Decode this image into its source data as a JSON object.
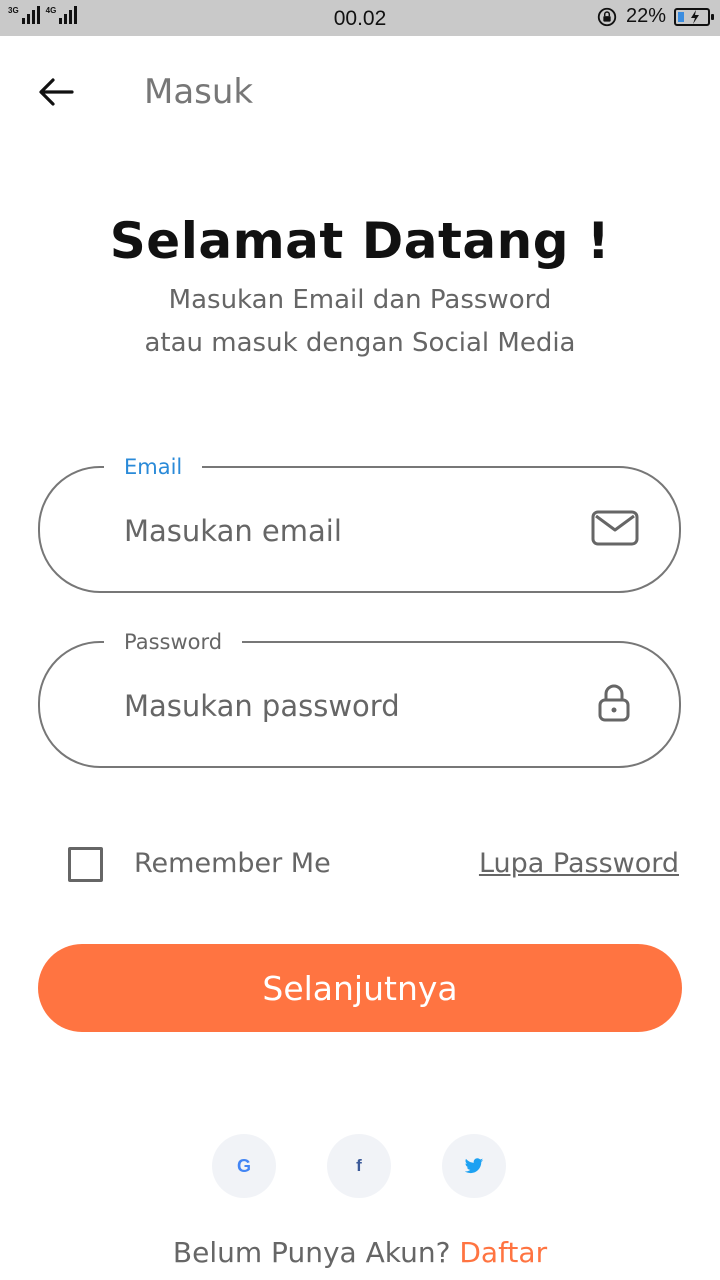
{
  "status_bar": {
    "signal1_label": "3G",
    "signal2_label": "4G",
    "time": "00.02",
    "battery_percent": "22%",
    "battery_level": 0.22
  },
  "app_bar": {
    "back_icon": "arrow-left-icon",
    "title": "Masuk"
  },
  "welcome": {
    "title": "Selamat Datang !",
    "subtitle_line1": "Masukan Email dan Password",
    "subtitle_line2": "atau masuk dengan Social Media"
  },
  "form": {
    "email": {
      "label": "Email",
      "placeholder": "Masukan email",
      "value": "",
      "icon": "mail-icon"
    },
    "password": {
      "label": "Password",
      "placeholder": "Masukan password",
      "value": "",
      "icon": "lock-icon"
    },
    "remember_label": "Remember Me",
    "remember_checked": false,
    "forgot_label": "Lupa Password",
    "submit_label": "Selanjutnya"
  },
  "social": {
    "google_glyph": "G",
    "facebook_glyph": "f",
    "twitter_icon": "twitter-bird-icon"
  },
  "footer": {
    "prompt": "Belum Punya Akun?",
    "signup_label": "Daftar"
  },
  "colors": {
    "accent": "#ff7441",
    "focus_label": "#2a8ad8",
    "status_bar": "#c9c9c9"
  }
}
